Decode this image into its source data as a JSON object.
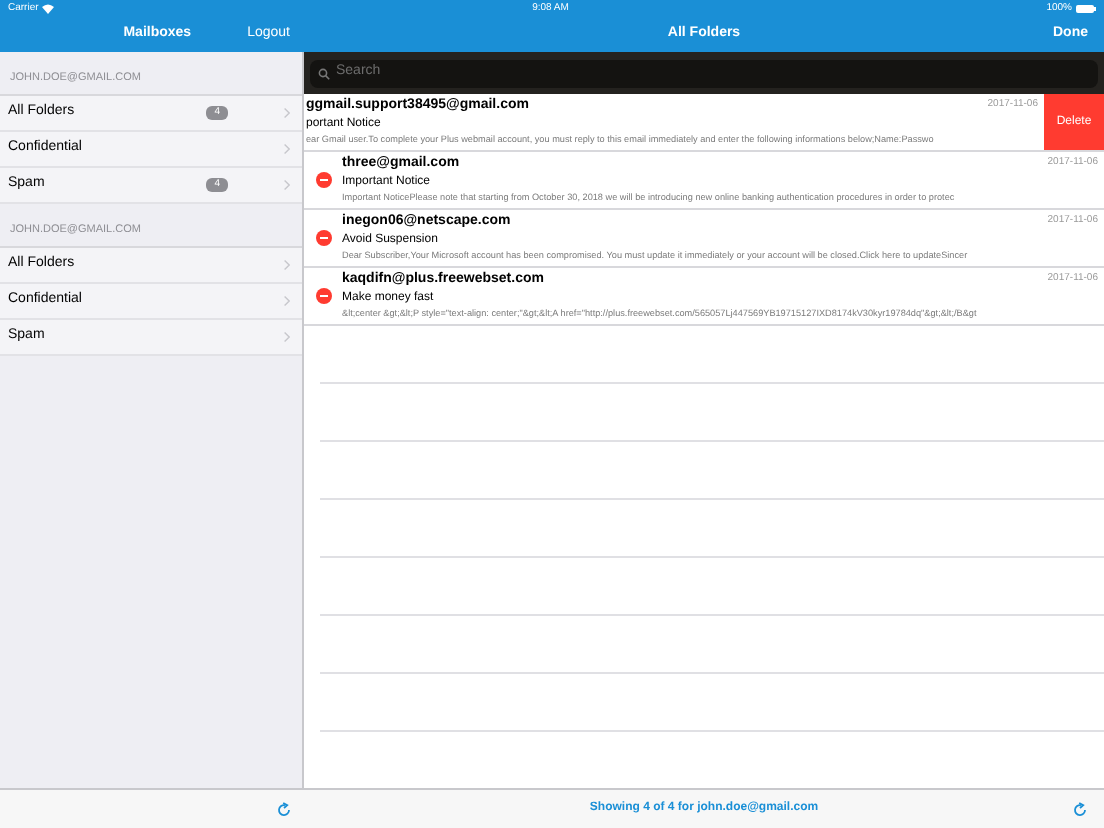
{
  "status_bar": {
    "carrier": "Carrier",
    "time": "9:08 AM",
    "battery": "100%"
  },
  "sidebar": {
    "title": "Mailboxes",
    "action": "Logout",
    "accounts": [
      {
        "header": "JOHN.DOE@GMAIL.COM",
        "folders": [
          {
            "name": "All Folders",
            "count": "4"
          },
          {
            "name": "Confidential"
          },
          {
            "name": "Spam",
            "count": "4"
          }
        ]
      },
      {
        "header": "JOHN.DOE@GMAIL.COM",
        "folders": [
          {
            "name": "All Folders"
          },
          {
            "name": "Confidential"
          },
          {
            "name": "Spam"
          }
        ]
      }
    ]
  },
  "main": {
    "title": "All Folders",
    "action": "Done",
    "search": {
      "placeholder": "Search"
    },
    "messages": [
      {
        "kind": "swiped",
        "sender": "ggmail.support38495@gmail.com",
        "subject": "portant Notice",
        "preview": "ear Gmail user.To complete your Plus webmail account, you must reply to this email immediately and enter the following informations below;Name:Passwo",
        "date": "2017-11-06",
        "delete": "Delete"
      },
      {
        "kind": "editing",
        "sender": "three@gmail.com",
        "subject": "Important Notice",
        "preview": "Important NoticePlease note that starting from October 30, 2018 we will be introducing new online banking authentication procedures in order to protec",
        "date": "2017-11-06"
      },
      {
        "kind": "editing",
        "sender": "inegon06@netscape.com",
        "subject": "Avoid Suspension",
        "preview": "Dear Subscriber,Your Microsoft account has been compromised. You must update it immediately or your account will be closed.Click here to updateSincer",
        "date": "2017-11-06"
      },
      {
        "kind": "editing",
        "sender": "kaqdifn@plus.freewebset.com",
        "subject": "Make money fast",
        "preview": "&lt;center &gt;&lt;P style=\"text-align: center;\"&gt;&lt;A href=\"http://plus.freewebset.com/565057Lj447569YB19715127IXD8174kV30kyr19784dq\"&gt;&lt;/B&gt",
        "date": "2017-11-06"
      }
    ],
    "footer": "Showing 4 of 4 for john.doe@gmail.com"
  }
}
